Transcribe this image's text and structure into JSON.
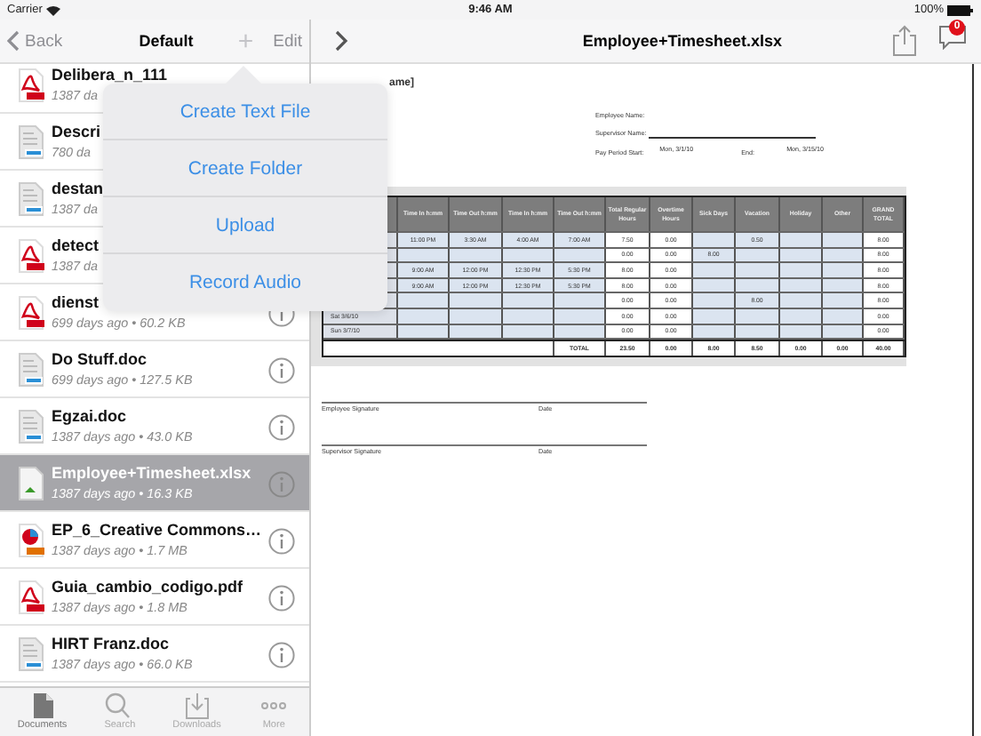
{
  "status_bar": {
    "carrier": "Carrier",
    "time": "9:46 AM",
    "battery": "100%"
  },
  "left_nav": {
    "back": "Back",
    "title": "Default",
    "add": "+",
    "edit": "Edit"
  },
  "files": [
    {
      "name": "Delibera_n_111",
      "meta": "1387 da",
      "kind": "pdf",
      "selected": false
    },
    {
      "name": "Descri",
      "meta": "780 da",
      "kind": "doc",
      "selected": false
    },
    {
      "name": "destan",
      "meta": "1387 da",
      "kind": "doc",
      "selected": false
    },
    {
      "name": "detect",
      "meta": "1387 da",
      "kind": "pdf",
      "selected": false
    },
    {
      "name": "dienst",
      "meta": "699 days ago • 60.2 KB",
      "kind": "pdf",
      "selected": false
    },
    {
      "name": "Do Stuff.doc",
      "meta": "699 days ago • 127.5 KB",
      "kind": "doc",
      "selected": false
    },
    {
      "name": "Egzai.doc",
      "meta": "1387 days ago • 43.0 KB",
      "kind": "doc",
      "selected": false
    },
    {
      "name": "Employee+Timesheet.xlsx",
      "meta": "1387 days ago • 16.3 KB",
      "kind": "xlsx",
      "selected": true
    },
    {
      "name": "EP_6_Creative Commons…",
      "meta": "1387 days ago • 1.7 MB",
      "kind": "ppt",
      "selected": false
    },
    {
      "name": "Guia_cambio_codigo.pdf",
      "meta": "1387 days ago • 1.8 MB",
      "kind": "pdf",
      "selected": false
    },
    {
      "name": "HIRT Franz.doc",
      "meta": "1387 days ago • 66.0 KB",
      "kind": "doc",
      "selected": false
    }
  ],
  "popover": [
    "Create Text File",
    "Create Folder",
    "Upload",
    "Record Audio"
  ],
  "tab_bar": [
    {
      "label": "Documents",
      "kind": "documents",
      "selected": true
    },
    {
      "label": "Search",
      "kind": "search",
      "selected": false
    },
    {
      "label": "Downloads",
      "kind": "downloads",
      "selected": false
    },
    {
      "label": "More",
      "kind": "more",
      "selected": false
    }
  ],
  "doc_nav": {
    "title": "Employee+Timesheet.xlsx",
    "badge": "0"
  },
  "document": {
    "heading": "ame]",
    "employee_label": "Employee Name:",
    "supervisor_label": "Supervisor Name:",
    "period_label": "Pay Period Start:",
    "period_start": "Mon, 3/1/10",
    "end_label": "End:",
    "period_end": "Mon, 3/15/10",
    "columns": [
      "",
      "Time In h:mm",
      "Time Out h:mm",
      "Time In h:mm",
      "Time Out h:mm",
      "Total Regular Hours",
      "Overtime Hours",
      "Sick Days",
      "Vacation",
      "Holiday",
      "Other",
      "GRAND TOTAL"
    ],
    "rows": [
      [
        "",
        "11:00 PM",
        "3:30 AM",
        "4:00 AM",
        "7:00 AM",
        "7.50",
        "0.00",
        "",
        "0.50",
        "",
        "",
        "8.00"
      ],
      [
        "",
        "",
        "",
        "",
        "",
        "0.00",
        "0.00",
        "8.00",
        "",
        "",
        "",
        "8.00"
      ],
      [
        "",
        "9:00 AM",
        "12:00 PM",
        "12:30 PM",
        "5:30 PM",
        "8.00",
        "0.00",
        "",
        "",
        "",
        "",
        "8.00"
      ],
      [
        "",
        "9:00 AM",
        "12:00 PM",
        "12:30 PM",
        "5:30 PM",
        "8.00",
        "0.00",
        "",
        "",
        "",
        "",
        "8.00"
      ],
      [
        "",
        "",
        "",
        "",
        "",
        "0.00",
        "0.00",
        "",
        "8.00",
        "",
        "",
        "8.00"
      ],
      [
        "Sat 3/6/10",
        "",
        "",
        "",
        "",
        "0.00",
        "0.00",
        "",
        "",
        "",
        "",
        "0.00"
      ],
      [
        "Sun 3/7/10",
        "",
        "",
        "",
        "",
        "0.00",
        "0.00",
        "",
        "",
        "",
        "",
        "0.00"
      ]
    ],
    "total_label": "TOTAL",
    "totals": [
      "23.50",
      "0.00",
      "8.00",
      "8.50",
      "0.00",
      "0.00",
      "40.00"
    ],
    "signatures": [
      {
        "label": "Employee Signature",
        "date": "Date"
      },
      {
        "label": "Supervisor Signature",
        "date": "Date"
      }
    ]
  }
}
